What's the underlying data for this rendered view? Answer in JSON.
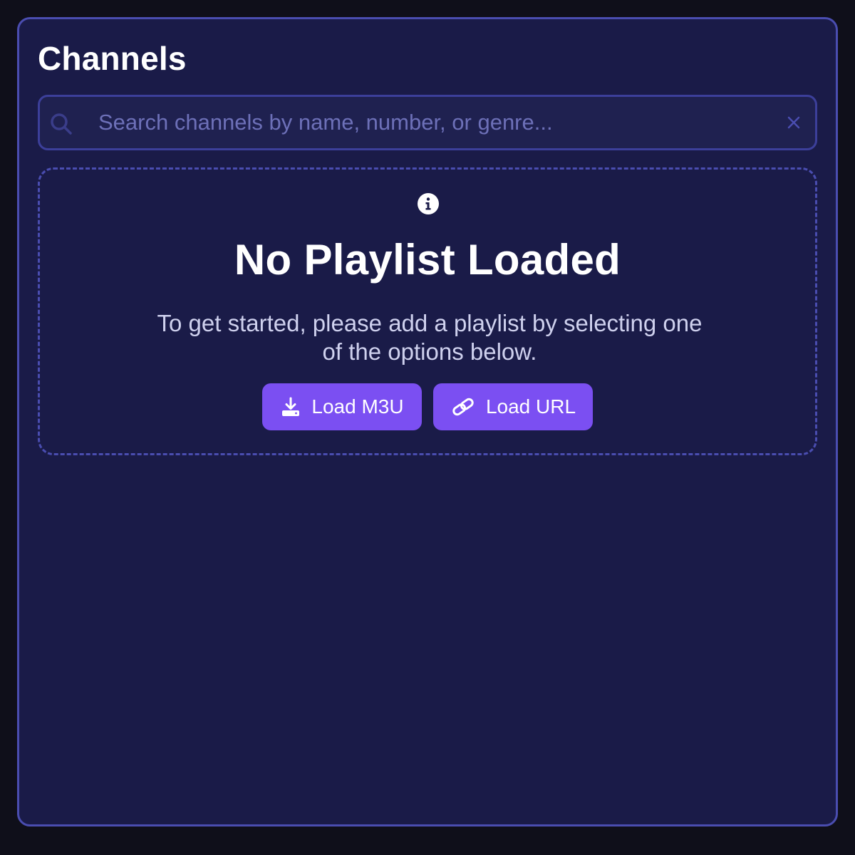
{
  "panel": {
    "title": "Channels"
  },
  "search": {
    "placeholder": "Search channels by name, number, or genre...",
    "value": "",
    "icon": "search-icon",
    "clear_icon": "close-icon"
  },
  "empty_state": {
    "icon": "info-icon",
    "title": "No Playlist Loaded",
    "description": "To get started, please add a playlist by selecting one of the options below.",
    "buttons": [
      {
        "label": "Load M3U",
        "icon": "download-icon"
      },
      {
        "label": "Load URL",
        "icon": "link-icon"
      }
    ]
  },
  "colors": {
    "background": "#0f0f1a",
    "panel": "#1a1b48",
    "border": "#4a4db0",
    "accent": "#7b4ff2",
    "text": "#ffffff",
    "muted_text": "#cfd1ee"
  }
}
